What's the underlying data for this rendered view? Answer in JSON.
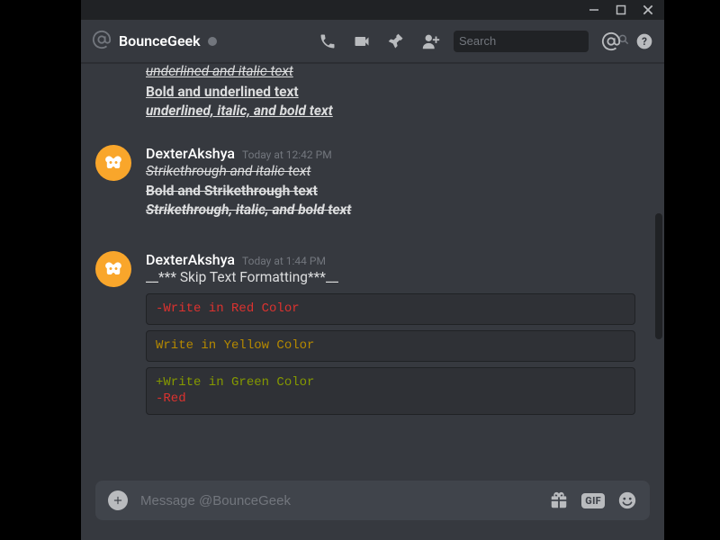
{
  "titlebar": {
    "min": "–",
    "max": "▢",
    "close": "✕"
  },
  "header": {
    "channel_name": "BounceGeek",
    "search_placeholder": "Search"
  },
  "top_partial": {
    "line1": "underlined and italic text",
    "line2": "Bold and underlined text",
    "line3": "underlined, italic, and bold text"
  },
  "msg1": {
    "username": "DexterAkshya",
    "timestamp": "Today at 12:42 PM",
    "line1": "Strikethrough and italic text",
    "line2": "Bold and Strikethrough text",
    "line3": "Strikethrough, italic, and bold text"
  },
  "msg2": {
    "username": "DexterAkshya",
    "timestamp": "Today at 1:44 PM",
    "line1": "__*** Skip Text Formatting***__",
    "code1": "-Write in Red Color",
    "code2": "Write in Yellow Color",
    "code3a": "+Write in Green Color",
    "code3b": "-Red"
  },
  "composer": {
    "placeholder": "Message @BounceGeek",
    "gif_label": "GIF"
  }
}
